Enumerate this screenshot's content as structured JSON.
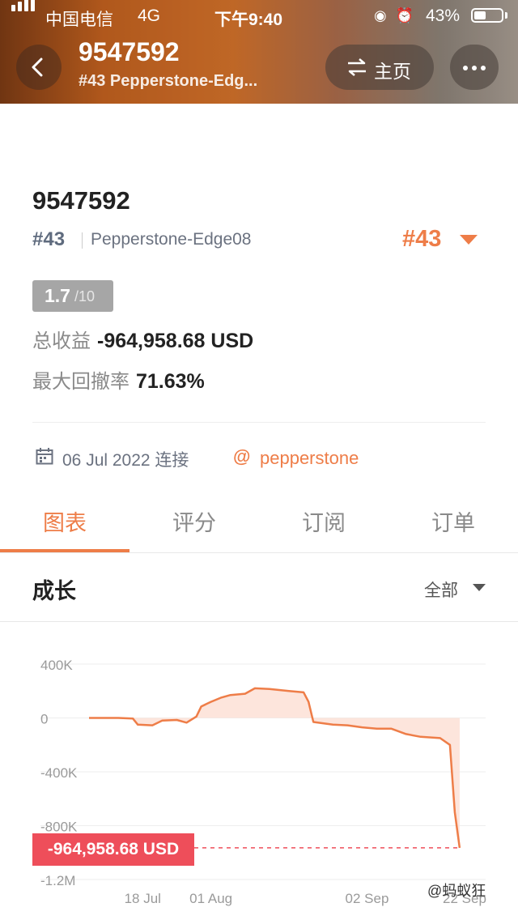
{
  "status_bar": {
    "carrier": "中国电信",
    "network": "4G",
    "time": "下午9:40",
    "battery": "43%",
    "battery_level": 0.43
  },
  "header": {
    "title": "9547592",
    "subtitle": "#43 Pepperstone-Edg...",
    "home_label": "主页"
  },
  "account": {
    "name": "9547592",
    "rank": "#43",
    "broker": "Pepperstone-Edge08",
    "rank_badge": "#43",
    "score": "1.7",
    "score_max": "/10",
    "total_profit_label": "总收益",
    "total_profit_value": "-964,958.68 USD",
    "drawdown_label": "最大回撤率",
    "drawdown_value": "71.63%",
    "connected_date": "06 Jul 2022 连接",
    "at_link": "pepperstone"
  },
  "tabs": [
    {
      "label": "图表",
      "active": true
    },
    {
      "label": "评分",
      "active": false
    },
    {
      "label": "订阅",
      "active": false
    },
    {
      "label": "订单",
      "active": false
    }
  ],
  "growth": {
    "title": "成长",
    "range": "全部"
  },
  "chart_data": {
    "type": "area",
    "ylim": [
      -1200000,
      400000
    ],
    "y_ticks": [
      400000,
      0,
      -400000,
      -800000,
      -1200000
    ],
    "y_tick_labels": [
      "400K",
      "0",
      "-400K",
      "-800K",
      "-1.2M"
    ],
    "x_tick_labels": [
      "18 Jul",
      "01 Aug",
      "02 Sep",
      "22 Sep"
    ],
    "x_tick_dates": [
      "2022-07-18",
      "2022-08-01",
      "2022-09-02",
      "2022-09-22"
    ],
    "x_range": [
      "2022-07-07",
      "2022-09-23"
    ],
    "grid": true,
    "final_value_label": "-964,958.68 USD",
    "final_value": -964958.68,
    "series": [
      {
        "points": [
          {
            "x": "2022-07-07",
            "y": 0
          },
          {
            "x": "2022-07-13",
            "y": 0
          },
          {
            "x": "2022-07-16",
            "y": -5000
          },
          {
            "x": "2022-07-17",
            "y": -50000
          },
          {
            "x": "2022-07-20",
            "y": -55000
          },
          {
            "x": "2022-07-22",
            "y": -20000
          },
          {
            "x": "2022-07-25",
            "y": -15000
          },
          {
            "x": "2022-07-27",
            "y": -35000
          },
          {
            "x": "2022-07-29",
            "y": 10000
          },
          {
            "x": "2022-07-30",
            "y": 85000
          },
          {
            "x": "2022-08-01",
            "y": 120000
          },
          {
            "x": "2022-08-03",
            "y": 150000
          },
          {
            "x": "2022-08-05",
            "y": 170000
          },
          {
            "x": "2022-08-08",
            "y": 180000
          },
          {
            "x": "2022-08-10",
            "y": 220000
          },
          {
            "x": "2022-08-13",
            "y": 215000
          },
          {
            "x": "2022-08-17",
            "y": 200000
          },
          {
            "x": "2022-08-20",
            "y": 190000
          },
          {
            "x": "2022-08-21",
            "y": 120000
          },
          {
            "x": "2022-08-22",
            "y": -30000
          },
          {
            "x": "2022-08-26",
            "y": -50000
          },
          {
            "x": "2022-08-29",
            "y": -55000
          },
          {
            "x": "2022-09-01",
            "y": -70000
          },
          {
            "x": "2022-09-04",
            "y": -80000
          },
          {
            "x": "2022-09-07",
            "y": -80000
          },
          {
            "x": "2022-09-10",
            "y": -120000
          },
          {
            "x": "2022-09-13",
            "y": -140000
          },
          {
            "x": "2022-09-17",
            "y": -150000
          },
          {
            "x": "2022-09-19",
            "y": -200000
          },
          {
            "x": "2022-09-20",
            "y": -700000
          },
          {
            "x": "2022-09-21",
            "y": -964958.68
          }
        ]
      }
    ]
  },
  "watermark": "@蚂蚁狂",
  "colors": {
    "accent": "#ee7d48",
    "fill": "#fde1d6",
    "final_tag": "#ee4e5a",
    "grid": "#eeeeee",
    "axis_text": "#9a9a9a"
  }
}
